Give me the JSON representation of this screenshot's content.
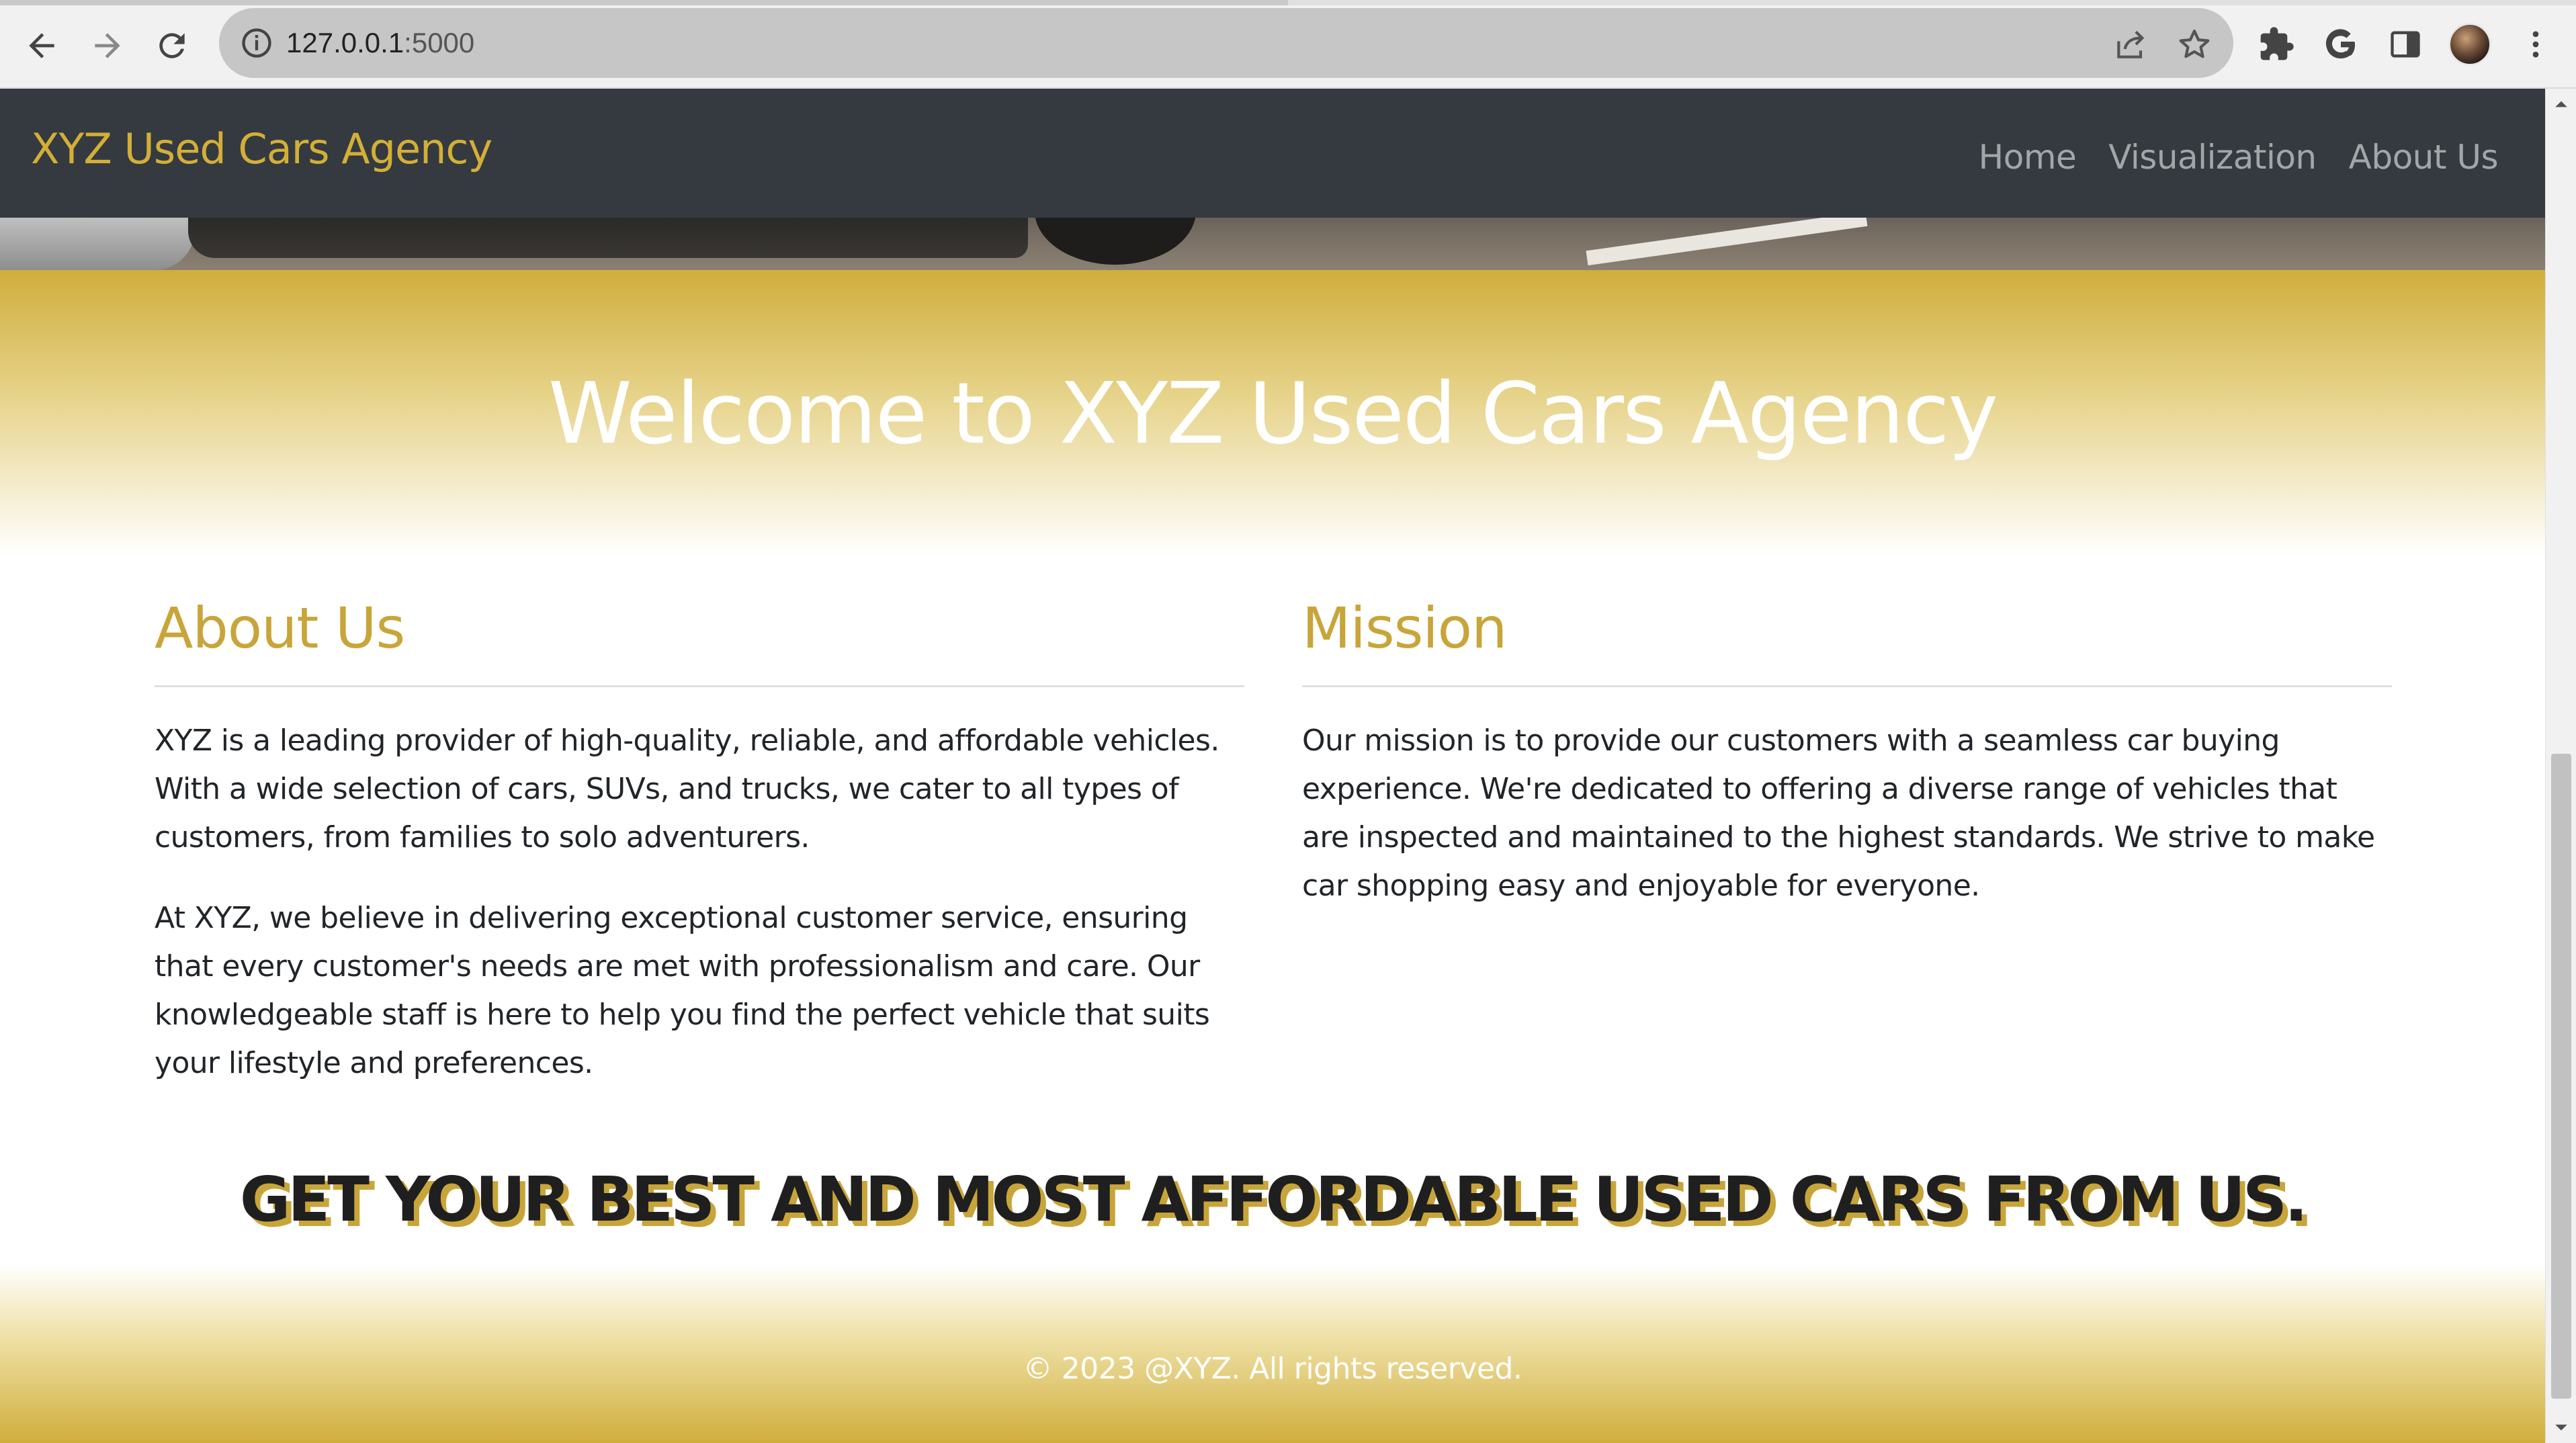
{
  "browser": {
    "url_host": "127.0.0.1",
    "url_port": ":5000",
    "load_progress": 0.5,
    "icons": {
      "back": "back-arrow-icon",
      "forward": "forward-arrow-icon",
      "reload": "reload-icon",
      "site_info": "info-icon",
      "share": "share-icon",
      "bookmark": "star-icon",
      "extensions": "puzzle-icon",
      "google": "google-g-icon",
      "side_panel": "side-panel-icon",
      "profile": "avatar",
      "menu": "kebab-menu-icon"
    }
  },
  "navbar": {
    "brand": "XYZ Used Cars Agency",
    "links": [
      {
        "label": "Home"
      },
      {
        "label": "Visualization"
      },
      {
        "label": "About Us"
      }
    ]
  },
  "hero": {
    "title": "Welcome to XYZ Used Cars Agency"
  },
  "about": {
    "heading": "About Us",
    "paragraphs": [
      "XYZ is a leading provider of high-quality, reliable, and affordable vehicles. With a wide selection of cars, SUVs, and trucks, we cater to all types of customers, from families to solo adventurers.",
      "At XYZ, we believe in delivering exceptional customer service, ensuring that every customer's needs are met with professionalism and care. Our knowledgeable staff is here to help you find the perfect vehicle that suits your lifestyle and preferences."
    ]
  },
  "mission": {
    "heading": "Mission",
    "paragraphs": [
      "Our mission is to provide our customers with a seamless car buying experience. We're dedicated to offering a diverse range of vehicles that are inspected and maintained to the highest standards. We strive to make car shopping easy and enjoyable for everyone."
    ]
  },
  "tagline": "GET YOUR BEST AND MOST AFFORDABLE USED CARS FROM US.",
  "footer": {
    "text": "© 2023 @XYZ. All rights reserved."
  },
  "colors": {
    "accent_gold": "#d4af37",
    "heading_gold": "#c8a53a",
    "navbar_bg": "#343a40",
    "body_text": "#212529"
  }
}
